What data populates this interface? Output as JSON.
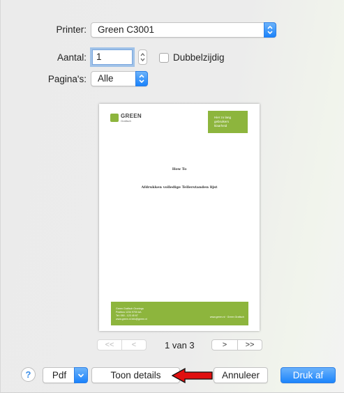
{
  "printer": {
    "label": "Printer:",
    "value": "Green C3001"
  },
  "copies": {
    "label": "Aantal:",
    "value": "1"
  },
  "duplex": {
    "label": "Dubbelzijdig",
    "checked": false
  },
  "pages": {
    "label": "Pagina's:",
    "value": "Alle"
  },
  "preview": {
    "logo_text": "GREEN",
    "logo_sub": "Grafisch",
    "tag_lines": [
      "Hier zo lang",
      "gebruikers",
      "klaarheid"
    ],
    "doc_title": "How To",
    "doc_subtitle": "Afdrukken volledige Tellerstanden lijst",
    "footer_lines": [
      "Green Grafisch Gronings",
      "Postbus 1234  9700 AA",
      "Tel: 050 - 123 45 67",
      "www.green.nl   info@green.nl"
    ],
    "footer_right": "www.green.nl · Green Grafisch"
  },
  "nav": {
    "first": "<<",
    "prev": "<",
    "page_count": "1 van 3",
    "next": ">",
    "last": ">>"
  },
  "footer": {
    "help": "?",
    "pdf": "Pdf",
    "details": "Toon details",
    "cancel": "Annuleer",
    "print": "Druk af"
  },
  "colors": {
    "accent": "#1c85fb",
    "brand_green": "#8db53d",
    "annotation_red": "#e01010"
  }
}
